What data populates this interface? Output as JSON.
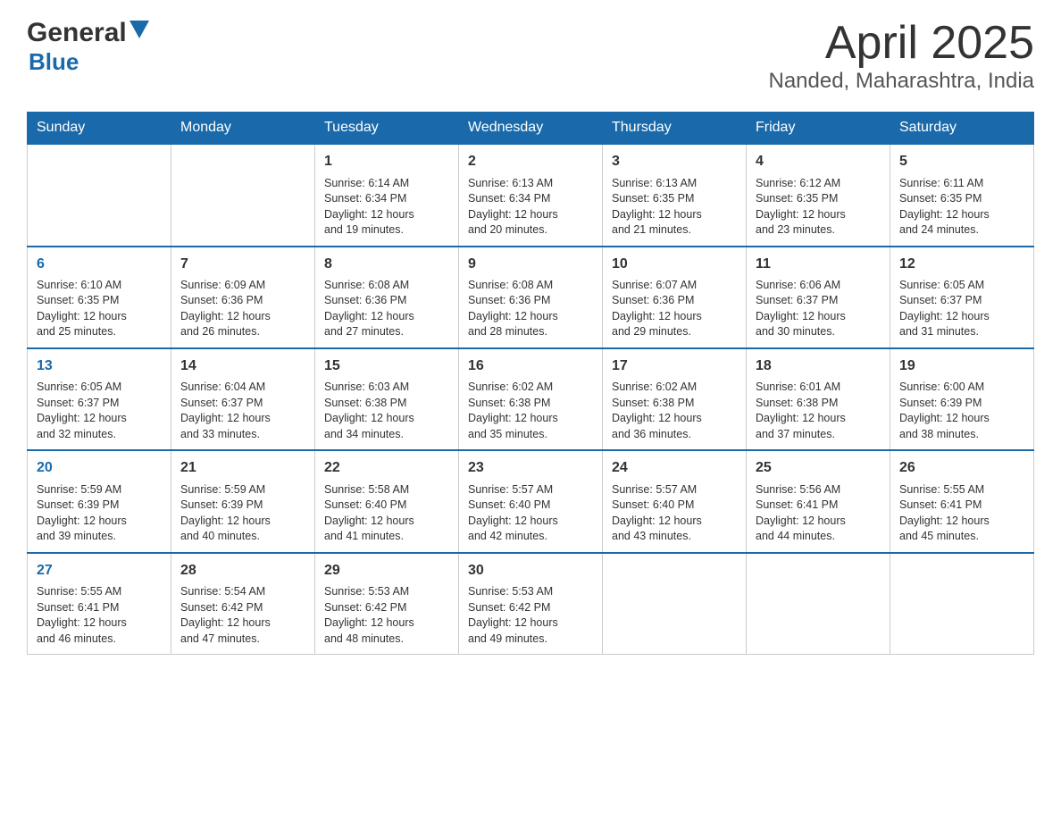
{
  "header": {
    "logo_general": "General",
    "logo_blue": "Blue",
    "title": "April 2025",
    "location": "Nanded, Maharashtra, India"
  },
  "weekdays": [
    "Sunday",
    "Monday",
    "Tuesday",
    "Wednesday",
    "Thursday",
    "Friday",
    "Saturday"
  ],
  "weeks": [
    [
      {
        "day": "",
        "info": ""
      },
      {
        "day": "",
        "info": ""
      },
      {
        "day": "1",
        "info": "Sunrise: 6:14 AM\nSunset: 6:34 PM\nDaylight: 12 hours\nand 19 minutes."
      },
      {
        "day": "2",
        "info": "Sunrise: 6:13 AM\nSunset: 6:34 PM\nDaylight: 12 hours\nand 20 minutes."
      },
      {
        "day": "3",
        "info": "Sunrise: 6:13 AM\nSunset: 6:35 PM\nDaylight: 12 hours\nand 21 minutes."
      },
      {
        "day": "4",
        "info": "Sunrise: 6:12 AM\nSunset: 6:35 PM\nDaylight: 12 hours\nand 23 minutes."
      },
      {
        "day": "5",
        "info": "Sunrise: 6:11 AM\nSunset: 6:35 PM\nDaylight: 12 hours\nand 24 minutes."
      }
    ],
    [
      {
        "day": "6",
        "info": "Sunrise: 6:10 AM\nSunset: 6:35 PM\nDaylight: 12 hours\nand 25 minutes."
      },
      {
        "day": "7",
        "info": "Sunrise: 6:09 AM\nSunset: 6:36 PM\nDaylight: 12 hours\nand 26 minutes."
      },
      {
        "day": "8",
        "info": "Sunrise: 6:08 AM\nSunset: 6:36 PM\nDaylight: 12 hours\nand 27 minutes."
      },
      {
        "day": "9",
        "info": "Sunrise: 6:08 AM\nSunset: 6:36 PM\nDaylight: 12 hours\nand 28 minutes."
      },
      {
        "day": "10",
        "info": "Sunrise: 6:07 AM\nSunset: 6:36 PM\nDaylight: 12 hours\nand 29 minutes."
      },
      {
        "day": "11",
        "info": "Sunrise: 6:06 AM\nSunset: 6:37 PM\nDaylight: 12 hours\nand 30 minutes."
      },
      {
        "day": "12",
        "info": "Sunrise: 6:05 AM\nSunset: 6:37 PM\nDaylight: 12 hours\nand 31 minutes."
      }
    ],
    [
      {
        "day": "13",
        "info": "Sunrise: 6:05 AM\nSunset: 6:37 PM\nDaylight: 12 hours\nand 32 minutes."
      },
      {
        "day": "14",
        "info": "Sunrise: 6:04 AM\nSunset: 6:37 PM\nDaylight: 12 hours\nand 33 minutes."
      },
      {
        "day": "15",
        "info": "Sunrise: 6:03 AM\nSunset: 6:38 PM\nDaylight: 12 hours\nand 34 minutes."
      },
      {
        "day": "16",
        "info": "Sunrise: 6:02 AM\nSunset: 6:38 PM\nDaylight: 12 hours\nand 35 minutes."
      },
      {
        "day": "17",
        "info": "Sunrise: 6:02 AM\nSunset: 6:38 PM\nDaylight: 12 hours\nand 36 minutes."
      },
      {
        "day": "18",
        "info": "Sunrise: 6:01 AM\nSunset: 6:38 PM\nDaylight: 12 hours\nand 37 minutes."
      },
      {
        "day": "19",
        "info": "Sunrise: 6:00 AM\nSunset: 6:39 PM\nDaylight: 12 hours\nand 38 minutes."
      }
    ],
    [
      {
        "day": "20",
        "info": "Sunrise: 5:59 AM\nSunset: 6:39 PM\nDaylight: 12 hours\nand 39 minutes."
      },
      {
        "day": "21",
        "info": "Sunrise: 5:59 AM\nSunset: 6:39 PM\nDaylight: 12 hours\nand 40 minutes."
      },
      {
        "day": "22",
        "info": "Sunrise: 5:58 AM\nSunset: 6:40 PM\nDaylight: 12 hours\nand 41 minutes."
      },
      {
        "day": "23",
        "info": "Sunrise: 5:57 AM\nSunset: 6:40 PM\nDaylight: 12 hours\nand 42 minutes."
      },
      {
        "day": "24",
        "info": "Sunrise: 5:57 AM\nSunset: 6:40 PM\nDaylight: 12 hours\nand 43 minutes."
      },
      {
        "day": "25",
        "info": "Sunrise: 5:56 AM\nSunset: 6:41 PM\nDaylight: 12 hours\nand 44 minutes."
      },
      {
        "day": "26",
        "info": "Sunrise: 5:55 AM\nSunset: 6:41 PM\nDaylight: 12 hours\nand 45 minutes."
      }
    ],
    [
      {
        "day": "27",
        "info": "Sunrise: 5:55 AM\nSunset: 6:41 PM\nDaylight: 12 hours\nand 46 minutes."
      },
      {
        "day": "28",
        "info": "Sunrise: 5:54 AM\nSunset: 6:42 PM\nDaylight: 12 hours\nand 47 minutes."
      },
      {
        "day": "29",
        "info": "Sunrise: 5:53 AM\nSunset: 6:42 PM\nDaylight: 12 hours\nand 48 minutes."
      },
      {
        "day": "30",
        "info": "Sunrise: 5:53 AM\nSunset: 6:42 PM\nDaylight: 12 hours\nand 49 minutes."
      },
      {
        "day": "",
        "info": ""
      },
      {
        "day": "",
        "info": ""
      },
      {
        "day": "",
        "info": ""
      }
    ]
  ]
}
